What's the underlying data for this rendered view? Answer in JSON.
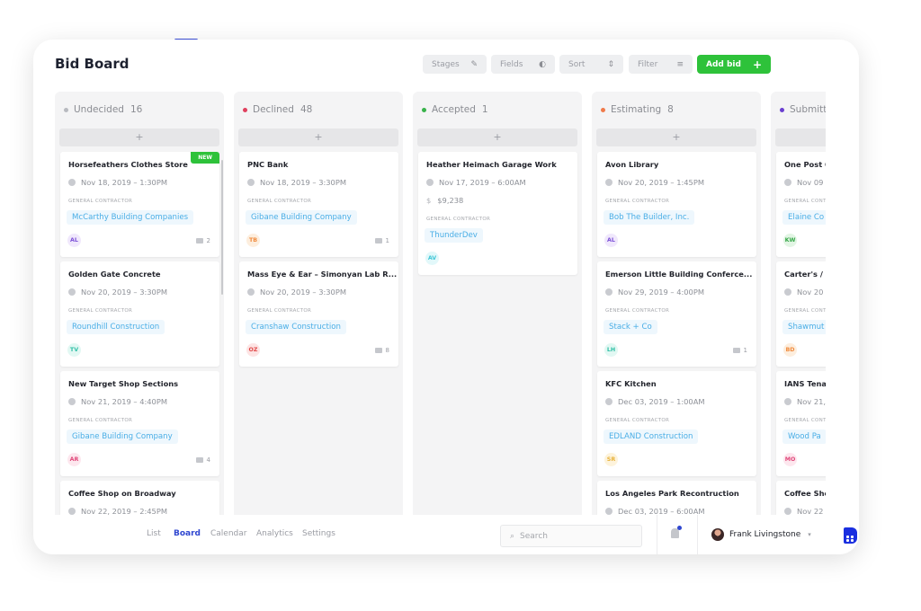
{
  "app": {
    "title": "Bid Board"
  },
  "toolbar": {
    "stages": {
      "label": "Stages",
      "icon": "edit-icon"
    },
    "fields": {
      "label": "Fields",
      "icon": "toggle-icon"
    },
    "sort": {
      "label": "Sort",
      "icon": "sort-icon"
    },
    "filter": {
      "label": "Filter",
      "icon": "filter-icon"
    },
    "add": {
      "label": "Add bid",
      "icon": "plus-icon"
    }
  },
  "label_gc": "GENERAL CONTRACTOR",
  "add_symbol": "+",
  "columns": [
    {
      "name": "Undecided",
      "count": "16",
      "color": "#b8bac0",
      "cards": [
        {
          "title": "Horsefeathers Clothes Store",
          "date": "Nov 18, 2019 – 1:30PM",
          "contractor": "McCarthy Building Companies",
          "avatar": "AL",
          "avatar_color": "#7b4fd6",
          "avatar_bg": "#f0e8fc",
          "comments": "2",
          "badge": "NEW"
        },
        {
          "title": "Golden Gate Concrete",
          "date": "Nov 20, 2019 – 3:30PM",
          "contractor": "Roundhill Construction",
          "avatar": "TV",
          "avatar_color": "#2fbfa6",
          "avatar_bg": "#e2f8f3"
        },
        {
          "title": "New Target Shop Sections",
          "date": "Nov 21, 2019 – 4:40PM",
          "contractor": "Gibane Building Company",
          "avatar": "AR",
          "avatar_color": "#e0487a",
          "avatar_bg": "#fde7ee",
          "comments": "4"
        },
        {
          "title": "Coffee Shop on Broadway",
          "date": "Nov 22, 2019 – 2:45PM"
        }
      ]
    },
    {
      "name": "Declined",
      "count": "48",
      "color": "#e0405e",
      "cards": [
        {
          "title": "PNC Bank",
          "date": "Nov 18, 2019 – 3:30PM",
          "contractor": "Gibane Building Company",
          "avatar": "TB",
          "avatar_color": "#f08a3c",
          "avatar_bg": "#fdeede",
          "comments": "1"
        },
        {
          "title": "Mass Eye & Ear – Simonyan Lab R...",
          "date": "Nov 20, 2019 – 3:30PM",
          "contractor": "Cranshaw Construction",
          "avatar": "OZ",
          "avatar_color": "#e04848",
          "avatar_bg": "#fde4e4",
          "comments": "8"
        }
      ]
    },
    {
      "name": "Accepted",
      "count": "1",
      "color": "#38b24a",
      "cards": [
        {
          "title": "Heather Heimach Garage Work",
          "date": "Nov 17, 2019 – 6:00AM",
          "amount": "$9,238",
          "contractor": "ThunderDev",
          "avatar": "AV",
          "avatar_color": "#3cc6d6",
          "avatar_bg": "#e2f8fa"
        }
      ]
    },
    {
      "name": "Estimating",
      "count": "8",
      "color": "#f07a4a",
      "cards": [
        {
          "title": "Avon Library",
          "date": "Nov 20, 2019 – 1:45PM",
          "contractor": "Bob The Builder, Inc.",
          "avatar": "AL",
          "avatar_color": "#7b4fd6",
          "avatar_bg": "#f0e8fc"
        },
        {
          "title": "Emerson Little Building Conferce...",
          "date": "Nov 29, 2019 – 4:00PM",
          "contractor": "Stack + Co",
          "avatar": "LH",
          "avatar_color": "#2fbfa6",
          "avatar_bg": "#e2f8f3",
          "comments": "1"
        },
        {
          "title": "KFC Kitchen",
          "date": "Dec 03, 2019 – 1:00AM",
          "contractor": "EDLAND Construction",
          "avatar": "SR",
          "avatar_color": "#e8b23a",
          "avatar_bg": "#fdf3dc"
        },
        {
          "title": "Los Angeles Park Recontruction",
          "date": "Dec 03, 2019 – 6:00AM"
        }
      ]
    },
    {
      "name": "Submitted",
      "count": "",
      "color": "#6a3fd0",
      "cards": [
        {
          "title": "One Post Office",
          "date": "Nov 09",
          "contractor": "Elaine Co",
          "avatar": "KW",
          "avatar_color": "#38a84a",
          "avatar_bg": "#e2f5e4"
        },
        {
          "title": "Carter's /",
          "date": "Nov 20",
          "contractor": "Shawmut",
          "avatar": "BD",
          "avatar_color": "#f08a3c",
          "avatar_bg": "#fdeede"
        },
        {
          "title": "IANS Tenant",
          "date": "Nov 21,",
          "contractor": "Wood Pa",
          "avatar": "MO",
          "avatar_color": "#e0487a",
          "avatar_bg": "#fde7ee"
        },
        {
          "title": "Coffee Shop",
          "date": "Nov 22"
        }
      ]
    }
  ],
  "bottom": {
    "nav": [
      {
        "label": "List"
      },
      {
        "label": "Board",
        "active": true
      },
      {
        "label": "Calendar"
      },
      {
        "label": "Analytics"
      },
      {
        "label": "Settings"
      }
    ],
    "search_placeholder": "Search",
    "user": "Frank Livingstone"
  },
  "colors": {
    "accent": "#2f47d0",
    "add": "#2ec23a",
    "logo": "#1a2fe0"
  }
}
